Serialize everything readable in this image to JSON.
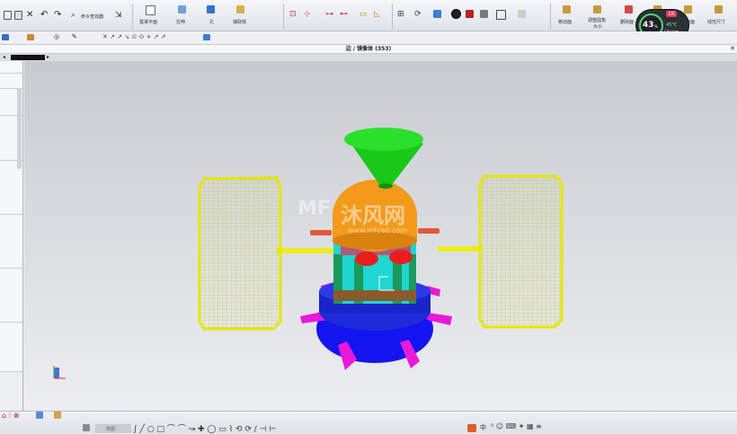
{
  "toolbar": {
    "command_finder": "命令查找器",
    "datum_plane_line1": "基准平面",
    "pull_face_line1": "拉伸",
    "hole": "孔",
    "extract_body": "抽取体",
    "move_face": "移动面",
    "resize_blend_line1": "调整圆角",
    "resize_blend_line2": "大小",
    "delete_face": "删除面",
    "offset_region": "偏置区域",
    "replace_face": "替换面",
    "linear_dimension": "线性尺寸"
  },
  "title": "边 / 镜像体 (353)",
  "monitor": {
    "percent": "43",
    "percent_sign": "%",
    "speed": "1K",
    "temp": "45°C",
    "cpu_label": "CPU温度"
  },
  "watermark": {
    "logo": "MF",
    "title": "沐风网",
    "url": "www.mfcad.com"
  },
  "bottom": {
    "sketch_label": "草图",
    "ime": "中"
  },
  "colors": {
    "panel_yellow": "#e6e600",
    "funnel_green": "#19c819",
    "dome_orange": "#f39a1a",
    "body_cyan": "#1fd6d0",
    "base_blue": "#1414f0",
    "leg_magenta": "#e81ad8",
    "accent_red": "#e81e1e",
    "brown": "#8b5a2b",
    "beam_yellow": "#ecec1e"
  }
}
